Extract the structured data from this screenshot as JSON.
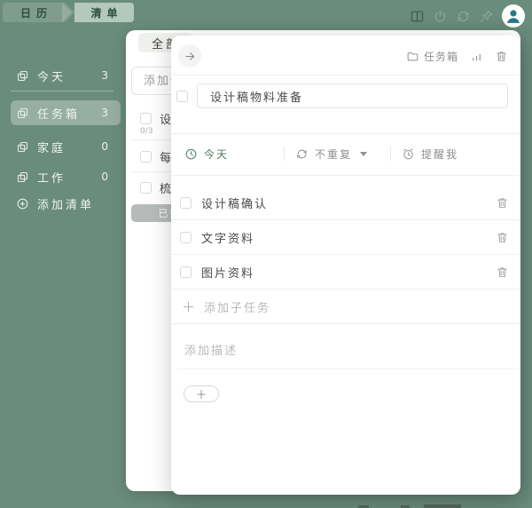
{
  "colors": {
    "background_green": "#6a8c7d",
    "accent_green": "#4a7c63",
    "avatar_teal": "#267789"
  },
  "topbar": {
    "tab_calendar": "日历",
    "tab_list": "清单",
    "icons": [
      "split-view-icon",
      "power-icon",
      "sync-icon",
      "pin-icon",
      "avatar"
    ]
  },
  "sidebar": {
    "items": [
      {
        "label": "今天",
        "count": "3"
      },
      {
        "label": "任务箱",
        "count": "3",
        "selected": true
      },
      {
        "label": "家庭",
        "count": "0"
      },
      {
        "label": "工作",
        "count": "0"
      }
    ],
    "add_list_label": "添加清单"
  },
  "list_panel": {
    "tab_all": "全部",
    "add_placeholder": "添加任务",
    "rows": [
      {
        "text": "设计稿物料准备",
        "progress": "0/3"
      },
      {
        "text": "每"
      },
      {
        "text": "梳"
      }
    ],
    "completed_button": "已完成"
  },
  "detail": {
    "list_name": "任务箱",
    "header_icons": [
      "folder-icon",
      "stats-icon",
      "trash-icon"
    ],
    "title": "设计稿物料准备",
    "meta": {
      "date": "今天",
      "repeat": "不重复",
      "remind": "提醒我"
    },
    "subtasks": [
      {
        "text": "设计稿确认"
      },
      {
        "text": "文字资料"
      },
      {
        "text": "图片资料"
      }
    ],
    "add_subtask_label": "添加子任务",
    "add_subtask_plus": "＋",
    "description_placeholder": "添加描述",
    "add_button_label": "＋"
  }
}
